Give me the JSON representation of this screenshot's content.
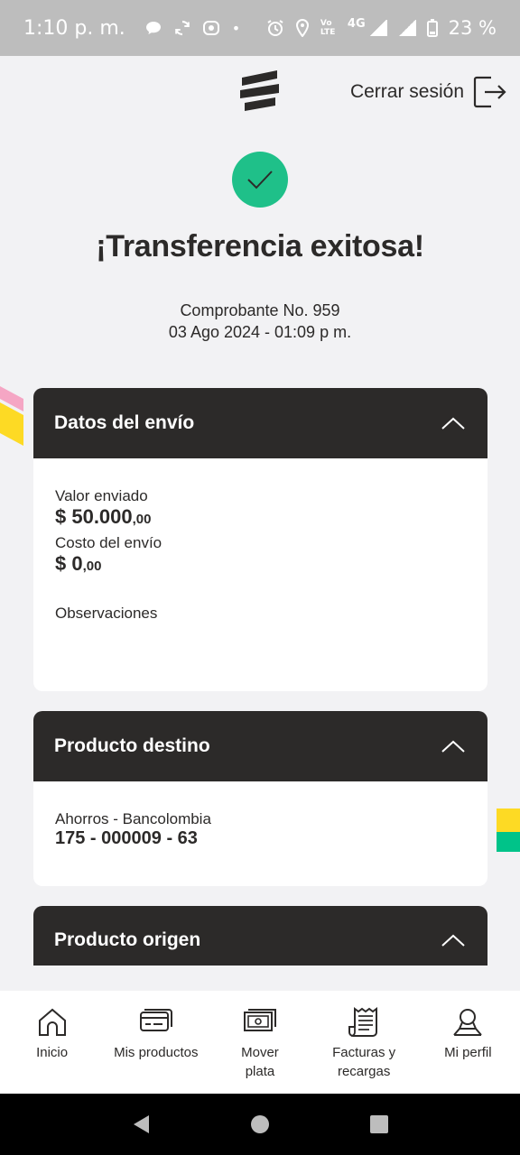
{
  "status_bar": {
    "time": "1:10 p. m.",
    "dot": "•",
    "network": "4G",
    "volte": "Vo LTE",
    "battery": "23 %"
  },
  "header": {
    "logout_label": "Cerrar sesión",
    "logo_icon": "bancolombia-logo-icon"
  },
  "result": {
    "title": "¡Transferencia exitosa!",
    "receipt": "Comprobante No. 959",
    "datetime": "03 Ago 2024 - 01:09 p m."
  },
  "send_data": {
    "heading": "Datos del envío",
    "value_label": "Valor enviado",
    "value_int": "$ 50.000",
    "value_dec": ",00",
    "cost_label": "Costo del envío",
    "cost_int": "$ 0",
    "cost_dec": ",00",
    "notes_label": "Observaciones"
  },
  "destination": {
    "heading": "Producto destino",
    "account_type": "Ahorros - Bancolombia",
    "account_number": "175 - 000009 - 63"
  },
  "origin": {
    "heading": "Producto origen"
  },
  "bottom_nav": {
    "items": [
      {
        "label": "Inicio",
        "icon": "home-icon"
      },
      {
        "label": "Mis productos",
        "icon": "cards-icon"
      },
      {
        "label": "Mover plata",
        "icon": "money-icon"
      },
      {
        "label": "Facturas y recargas",
        "icon": "receipt-icon"
      },
      {
        "label": "Mi perfil",
        "icon": "user-icon"
      }
    ]
  },
  "colors": {
    "dark": "#2c2a29",
    "success": "#1fc089",
    "yellow": "#fdda24",
    "pink": "#f5a6c4",
    "green": "#00c389"
  }
}
